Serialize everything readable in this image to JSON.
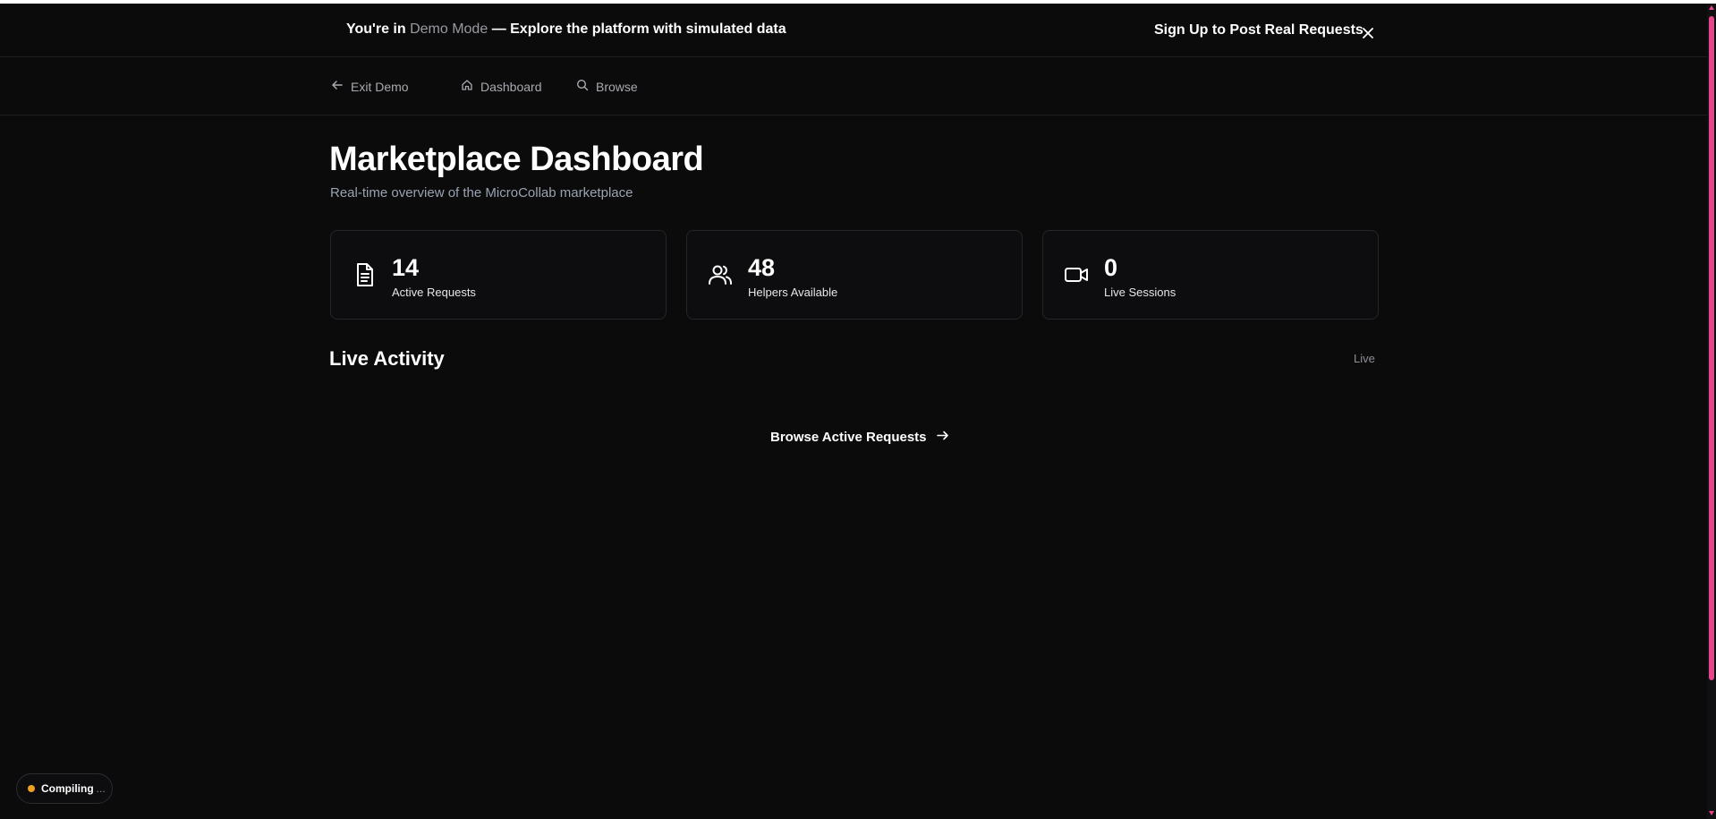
{
  "banner": {
    "prefix": "You're in",
    "mode": "Demo Mode",
    "suffix": "— Explore the platform with simulated data",
    "cta": "Sign Up to Post Real Requests",
    "close_icon": "close-icon"
  },
  "nav": {
    "items": [
      {
        "label": "Exit Demo",
        "icon": "arrow-left-icon"
      },
      {
        "label": "Dashboard",
        "icon": "home-icon"
      },
      {
        "label": "Browse",
        "icon": "search-icon"
      }
    ]
  },
  "main": {
    "title": "Marketplace Dashboard",
    "subtitle": "Real-time overview of the MicroCollab marketplace",
    "stats": [
      {
        "value": "14",
        "label": "Active Requests",
        "icon": "document-icon"
      },
      {
        "value": "48",
        "label": "Helpers Available",
        "icon": "users-icon"
      },
      {
        "value": "0",
        "label": "Live Sessions",
        "icon": "video-icon"
      }
    ],
    "activity": {
      "title": "Live Activity",
      "badge": "Live"
    },
    "browse_link": "Browse Active Requests"
  },
  "status": {
    "compiling": "Compiling",
    "ellipsis": "..."
  },
  "colors": {
    "background": "#0b0b0c",
    "scrollbar_accent": "#e5468a",
    "status_dot": "#f0a020"
  }
}
